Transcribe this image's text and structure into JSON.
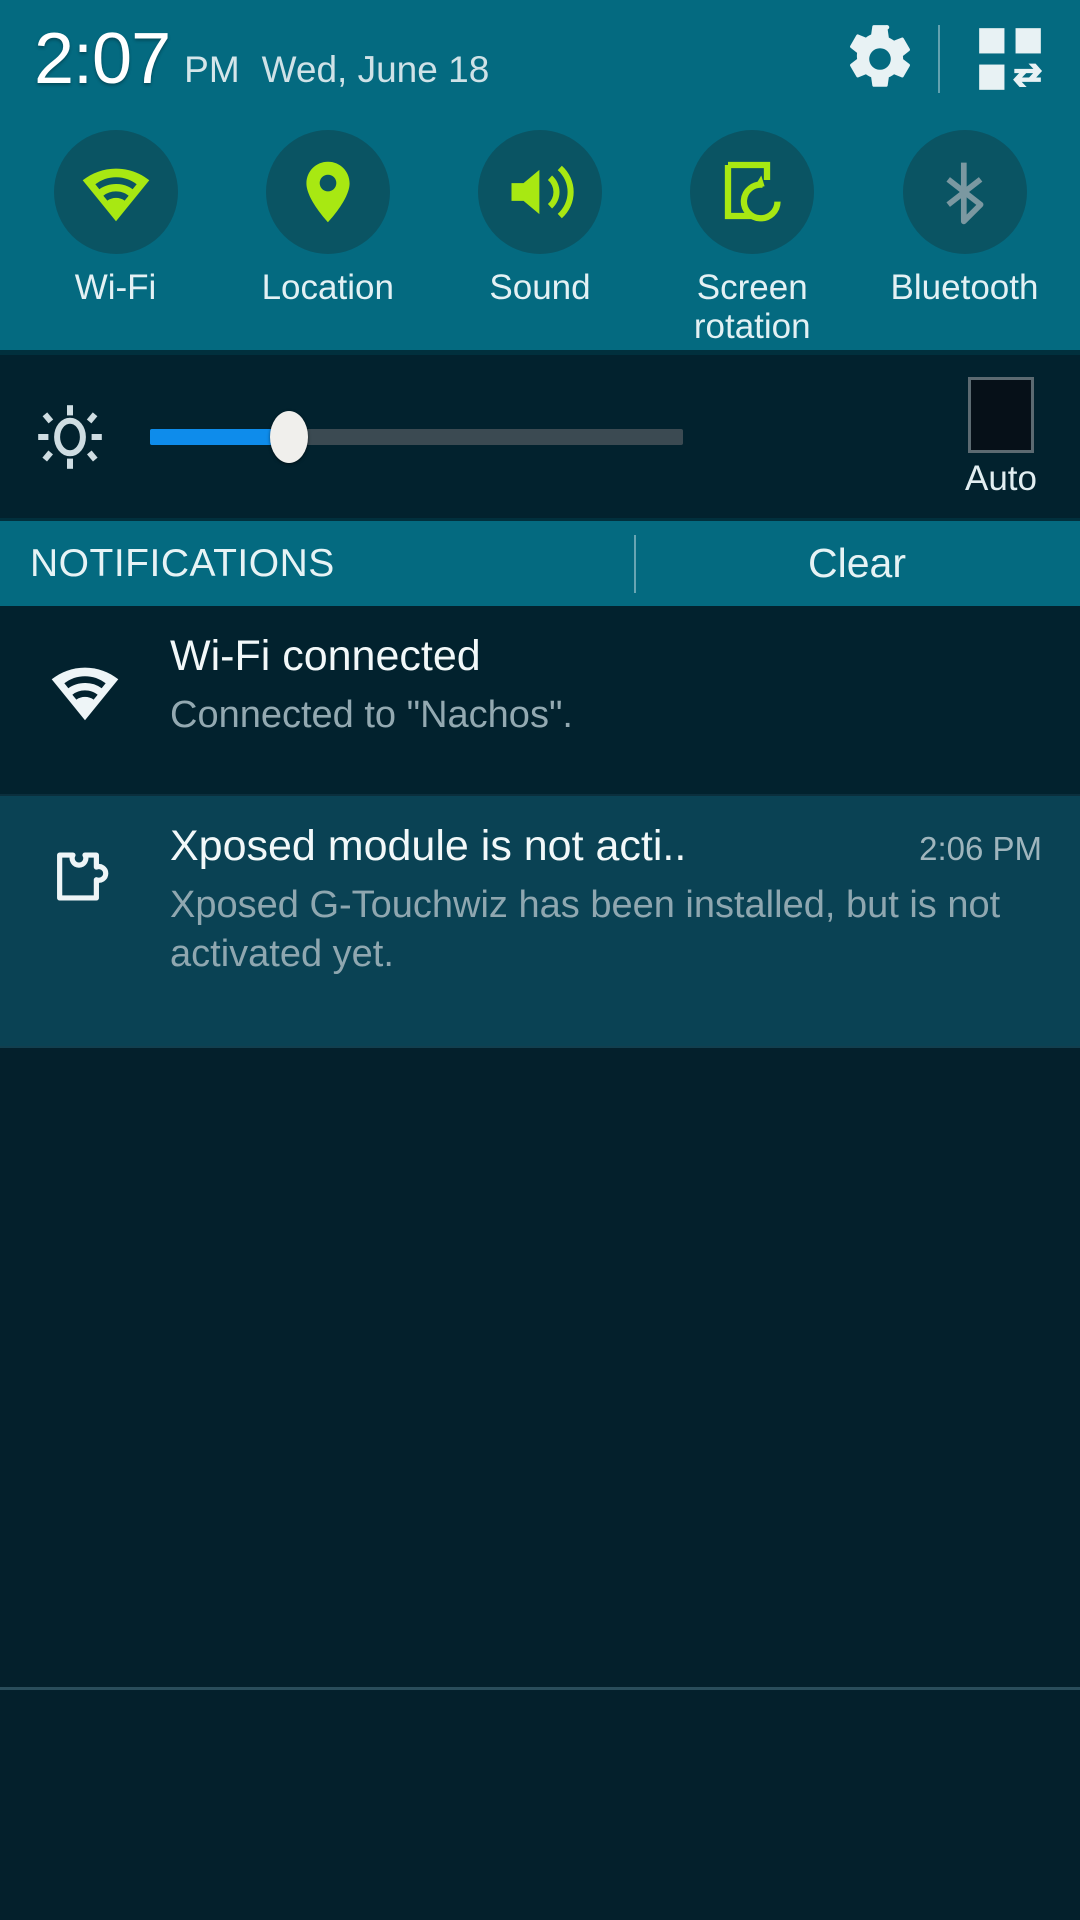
{
  "statusbar": {
    "time": "2:07",
    "ampm": "PM",
    "date": "Wed, June 18",
    "settings_icon": "gear-icon",
    "edit_icon": "quick-settings-grid-icon"
  },
  "quick_toggles": [
    {
      "label": "Wi-Fi",
      "icon": "wifi-icon",
      "state": "on",
      "color": "#a8e812"
    },
    {
      "label": "Location",
      "icon": "location-pin-icon",
      "state": "on",
      "color": "#a8e812"
    },
    {
      "label": "Sound",
      "icon": "speaker-sound-icon",
      "state": "on",
      "color": "#a8e812"
    },
    {
      "label": "Screen rotation",
      "icon": "screen-rotation-icon",
      "state": "on",
      "color": "#a8e812"
    },
    {
      "label": "Bluetooth",
      "icon": "bluetooth-icon",
      "state": "off",
      "color": "#6f8d96"
    }
  ],
  "brightness": {
    "icon": "brightness-sun-icon",
    "value_percent": 26,
    "fill_color": "#0e8ceb",
    "auto_label": "Auto",
    "auto_checked": false
  },
  "notifications_header": {
    "title": "NOTIFICATIONS",
    "clear_label": "Clear"
  },
  "notifications": [
    {
      "icon": "wifi-icon",
      "title": "Wi-Fi connected",
      "text": "Connected to \"Nachos\".",
      "time": "",
      "highlighted": false
    },
    {
      "icon": "puzzle-piece-icon",
      "title": "Xposed module is not acti..",
      "text": "Xposed G-Touchwiz has been installed, but is not activated yet.",
      "time": "2:06 PM",
      "highlighted": true
    }
  ],
  "theme": {
    "panel_teal": "#046a80",
    "toggle_circle": "#0a5463",
    "accent_green": "#a8e812",
    "dark_row": "#02222e",
    "highlight_row": "#0a4254",
    "background": "#04202c"
  }
}
